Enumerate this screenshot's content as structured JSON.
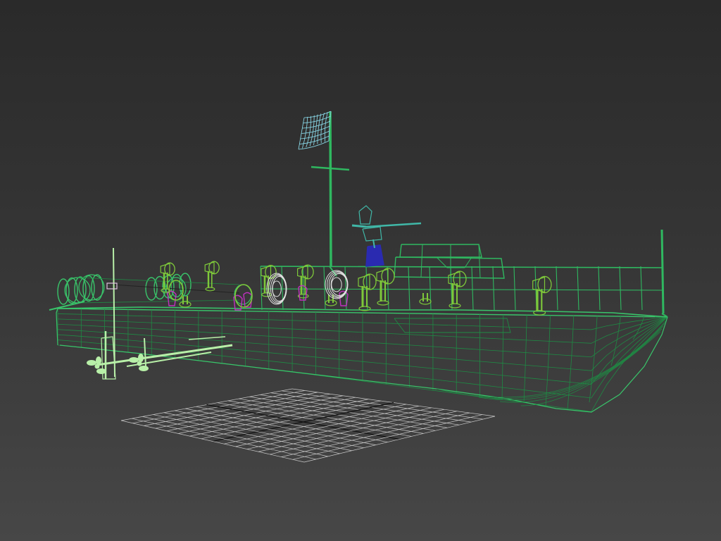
{
  "viewport": {
    "background_top": "#2a2a2a",
    "background_bottom": "#474747"
  },
  "scene": {
    "wireframe_colors": {
      "hull": "#2fb860",
      "hull_dark": "#1f8a44",
      "hull_fill": "#39c46a",
      "propeller_gear": "#b8f0a8",
      "flag": "#8ee0f0",
      "gun": "#40b8a8",
      "gun_mount": "#2a2ab0",
      "vents": "#7ec83a",
      "life_rings": "#e0e0e0",
      "fittings_magenta": "#c030c0",
      "ground_grid": "#c8c8c8",
      "ground_grid_axis": "#111111"
    },
    "objects": [
      {
        "name": "boat-hull"
      },
      {
        "name": "mast"
      },
      {
        "name": "flag"
      },
      {
        "name": "deck-gun"
      },
      {
        "name": "deck-railing"
      },
      {
        "name": "cabin"
      },
      {
        "name": "torpedo-tubes"
      },
      {
        "name": "vents"
      },
      {
        "name": "life-rings"
      },
      {
        "name": "propeller-shafts"
      },
      {
        "name": "home-grid"
      }
    ]
  }
}
